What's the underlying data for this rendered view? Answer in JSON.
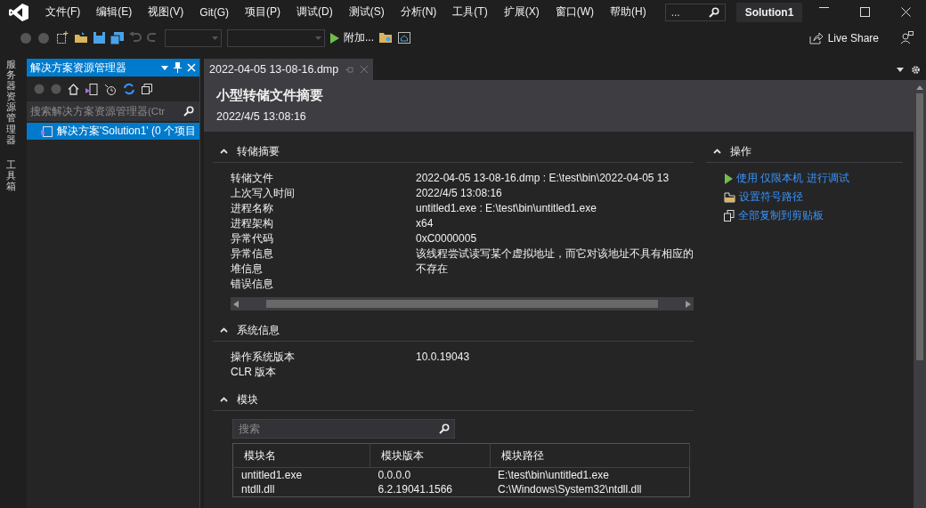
{
  "menu_bar": {
    "items": [
      "文件(F)",
      "编辑(E)",
      "视图(V)",
      "Git(G)",
      "项目(P)",
      "调试(D)",
      "测试(S)",
      "分析(N)",
      "工具(T)",
      "扩展(X)",
      "窗口(W)",
      "帮助(H)"
    ],
    "search_text": "...",
    "solution_name": "Solution1"
  },
  "toolbar": {
    "attach_label": "附加...",
    "live_share": "Live Share"
  },
  "side_strip": {
    "tabs": [
      "服务器资源管理器",
      "工具箱"
    ]
  },
  "solution_explorer": {
    "title": "解决方案资源管理器",
    "search": {
      "placeholder": "搜索解决方案资源管理器(Ctr"
    },
    "items": [
      {
        "label": "解决方案'Solution1' (0 个项目",
        "selected": true
      }
    ]
  },
  "document_tabs": [
    {
      "title": "2022-04-05 13-08-16.dmp",
      "selected": true
    }
  ],
  "summary_header": {
    "title": "小型转储文件摘要",
    "timestamp": "2022/4/5 13:08:16"
  },
  "sections": [
    {
      "kind": "properties",
      "title": "转储摘要",
      "expanded": true,
      "rows": [
        {
          "label": "转储文件",
          "value": "2022-04-05 13-08-16.dmp : E:\\test\\bin\\2022-04-05 13"
        },
        {
          "label": "上次写入时间",
          "value": "2022/4/5 13:08:16"
        },
        {
          "label": "进程名称",
          "value": "untitled1.exe : E:\\test\\bin\\untitled1.exe"
        },
        {
          "label": "进程架构",
          "value": "x64"
        },
        {
          "label": "异常代码",
          "value": "0xC0000005"
        },
        {
          "label": "异常信息",
          "value": "该线程尝试读写某个虚拟地址，而它对该地址不具有相应的"
        },
        {
          "label": "堆信息",
          "value": "不存在"
        },
        {
          "label": "错误信息"
        }
      ],
      "hscroll": true
    },
    {
      "kind": "properties",
      "title": "系统信息",
      "expanded": true,
      "rows": [
        {
          "label": "操作系统版本",
          "value": "10.0.19043"
        },
        {
          "label": "CLR 版本"
        }
      ]
    },
    {
      "kind": "modules",
      "title": "模块",
      "expanded": true,
      "search": {
        "placeholder": "搜索"
      },
      "columns": [
        "模块名",
        "模块版本",
        "模块路径"
      ],
      "rows": [
        [
          "untitled1.exe",
          "0.0.0.0",
          "E:\\test\\bin\\untitled1.exe"
        ],
        [
          "ntdll.dll",
          "6.2.19041.1566",
          "C:\\Windows\\System32\\ntdll.dll"
        ]
      ]
    }
  ],
  "actions": {
    "title": "操作",
    "expanded": true,
    "items": [
      {
        "kind": "play",
        "label": "使用 仅限本机 进行调试"
      },
      {
        "kind": "folder",
        "label": "设置符号路径"
      },
      {
        "kind": "copy",
        "label": "全部复制到剪贴板"
      }
    ]
  }
}
